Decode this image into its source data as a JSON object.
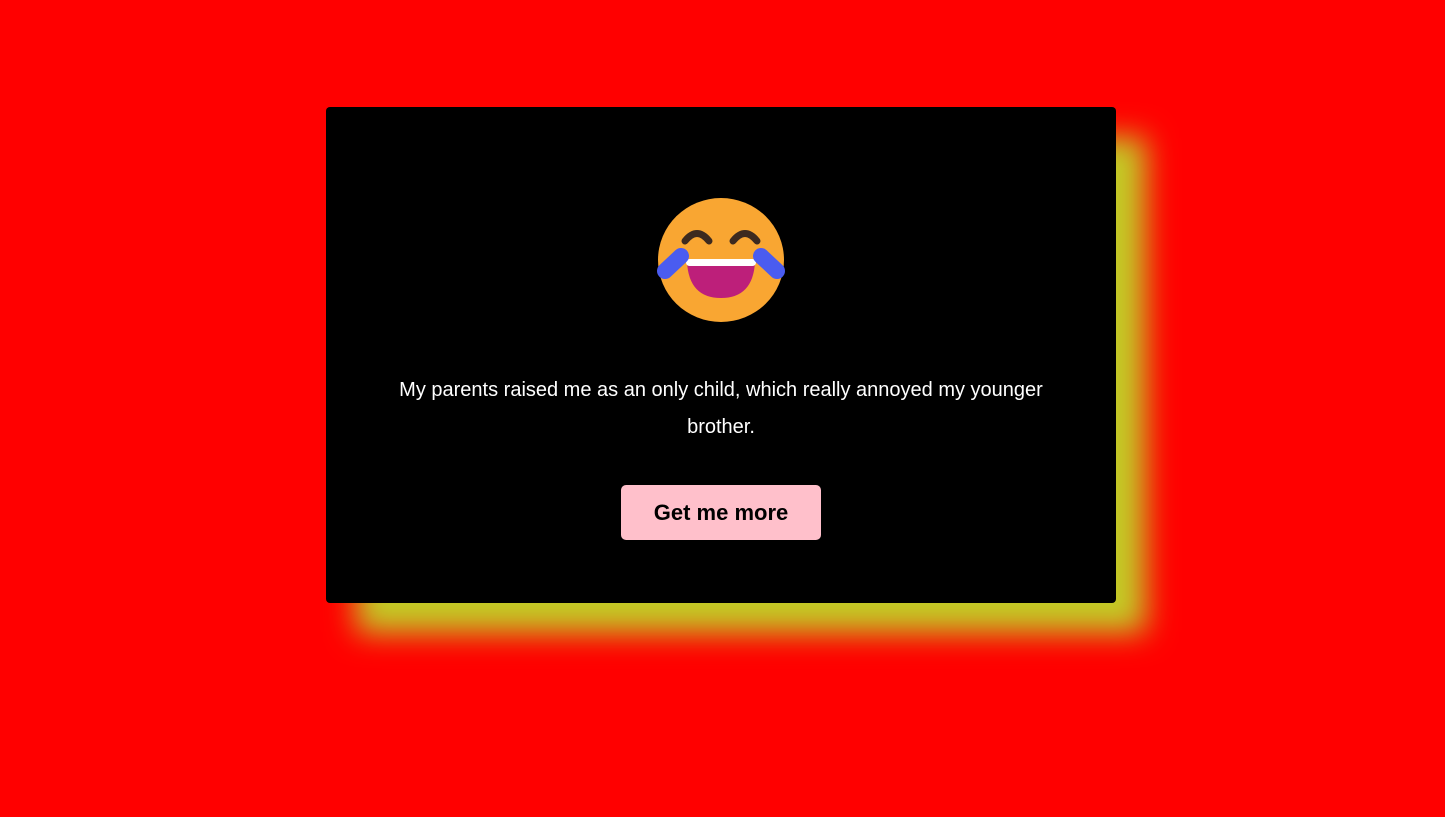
{
  "joke": {
    "text": "My parents raised me as an only child, which really annoyed my younger brother.",
    "emoji": "face-with-tears-of-joy-icon"
  },
  "button": {
    "label": "Get me more"
  },
  "colors": {
    "background": "#ff0000",
    "card": "#000000",
    "shadow": "#c0d628",
    "button": "#ffc0cb",
    "text": "#ffffff"
  }
}
